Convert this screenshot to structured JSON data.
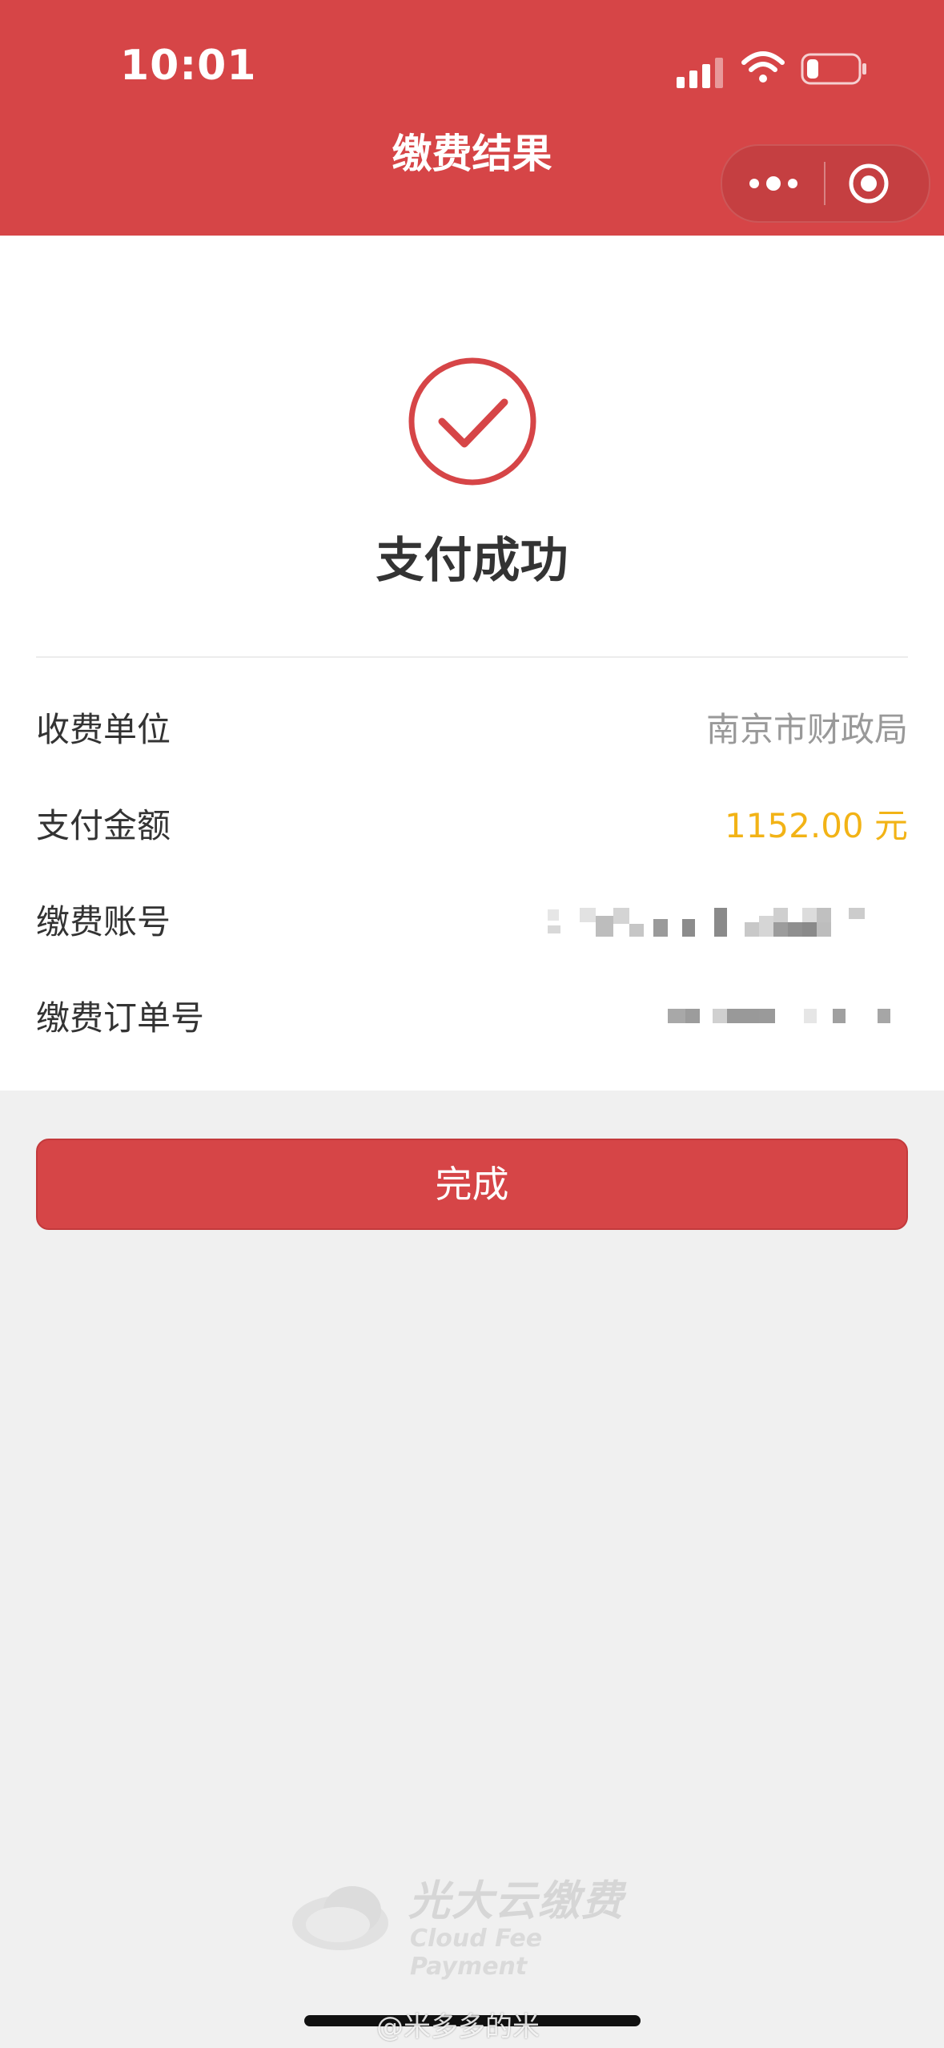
{
  "status_bar": {
    "time": "10:01"
  },
  "nav": {
    "title": "缴费结果",
    "more_icon": "more-dots-icon",
    "close_icon": "miniprogram-close-icon"
  },
  "result": {
    "icon": "check-circle-icon",
    "title": "支付成功"
  },
  "details": [
    {
      "label": "收费单位",
      "value": "南京市财政局"
    },
    {
      "label": "支付金额",
      "value": "1152.00 元"
    },
    {
      "label": "缴费账号",
      "value": ""
    },
    {
      "label": "缴费订单号",
      "value": ""
    }
  ],
  "actions": {
    "done_label": "完成"
  },
  "footer": {
    "brand_cn": "光大云缴费",
    "brand_en": "Cloud Fee Payment"
  },
  "watermark": "@米多多的米",
  "colors": {
    "primary_red": "#d64547",
    "amount_color": "#f2b316",
    "background": "#f0f0f0"
  }
}
